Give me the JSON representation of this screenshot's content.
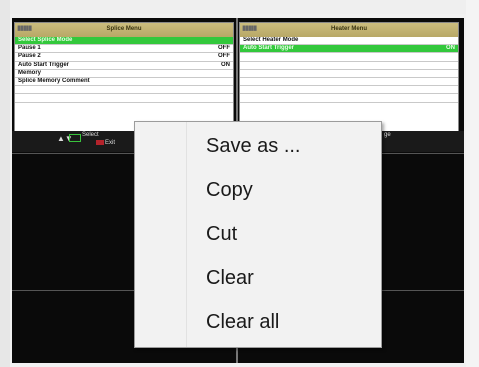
{
  "left_panel": {
    "title": "Splice Menu",
    "rows": [
      {
        "label": "Select Splice Mode",
        "value": "",
        "selected": true
      },
      {
        "label": "Pause 1",
        "value": "OFF",
        "selected": false
      },
      {
        "label": "Pause 2",
        "value": "OFF",
        "selected": false
      },
      {
        "label": "Auto Start Trigger",
        "value": "ON",
        "selected": false
      },
      {
        "label": "Memory",
        "value": "",
        "selected": false
      },
      {
        "label": "Splice Memory Comment",
        "value": "",
        "selected": false
      },
      {
        "label": "",
        "value": "",
        "selected": false
      },
      {
        "label": "",
        "value": "",
        "selected": false
      }
    ]
  },
  "right_panel": {
    "title": "Heater Menu",
    "rows": [
      {
        "label": "Select Heater Mode",
        "value": "",
        "selected": false
      },
      {
        "label": "Auto Start Trigger",
        "value": "ON",
        "selected": true
      },
      {
        "label": "",
        "value": "",
        "selected": false
      },
      {
        "label": "",
        "value": "",
        "selected": false
      },
      {
        "label": "",
        "value": "",
        "selected": false
      },
      {
        "label": "",
        "value": "",
        "selected": false
      },
      {
        "label": "",
        "value": "",
        "selected": false
      },
      {
        "label": "",
        "value": "",
        "selected": false
      }
    ]
  },
  "toolbar": {
    "select_label": "Select",
    "exit_label": "Exit",
    "right_label": "ge"
  },
  "context_menu": {
    "items": [
      "Save as ...",
      "Copy",
      "Cut",
      "Clear",
      "Clear all"
    ]
  },
  "colors": {
    "highlight": "#33c83c",
    "panel_header": "#c2b474",
    "menu_bg": "#f2f2f2"
  }
}
